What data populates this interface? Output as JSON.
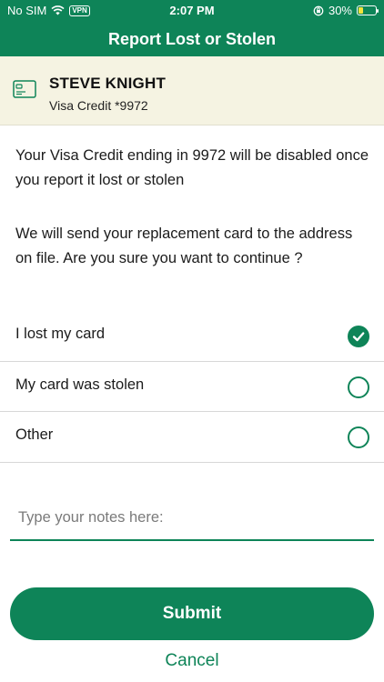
{
  "status_bar": {
    "carrier": "No SIM",
    "vpn": "VPN",
    "time": "2:07 PM",
    "battery": "30%",
    "battery_level": 0.3
  },
  "nav": {
    "title": "Report Lost or Stolen"
  },
  "card": {
    "name": "STEVE KNIGHT",
    "description": "Visa Credit *9972",
    "icon": "credit-card-icon"
  },
  "message": {
    "line1": "Your Visa Credit ending in 9972 will be disabled once you report it lost or stolen",
    "line2": "We will send your replacement card to the address on file. Are you sure you want to continue ?"
  },
  "options": [
    {
      "label": "I lost my card",
      "checked": true
    },
    {
      "label": "My card was stolen",
      "checked": false
    },
    {
      "label": "Other",
      "checked": false
    }
  ],
  "notes": {
    "placeholder": "Type your notes here:",
    "value": ""
  },
  "actions": {
    "submit": "Submit",
    "cancel": "Cancel"
  },
  "colors": {
    "primary": "#0e8458",
    "header_bg": "#f5f3e2"
  }
}
